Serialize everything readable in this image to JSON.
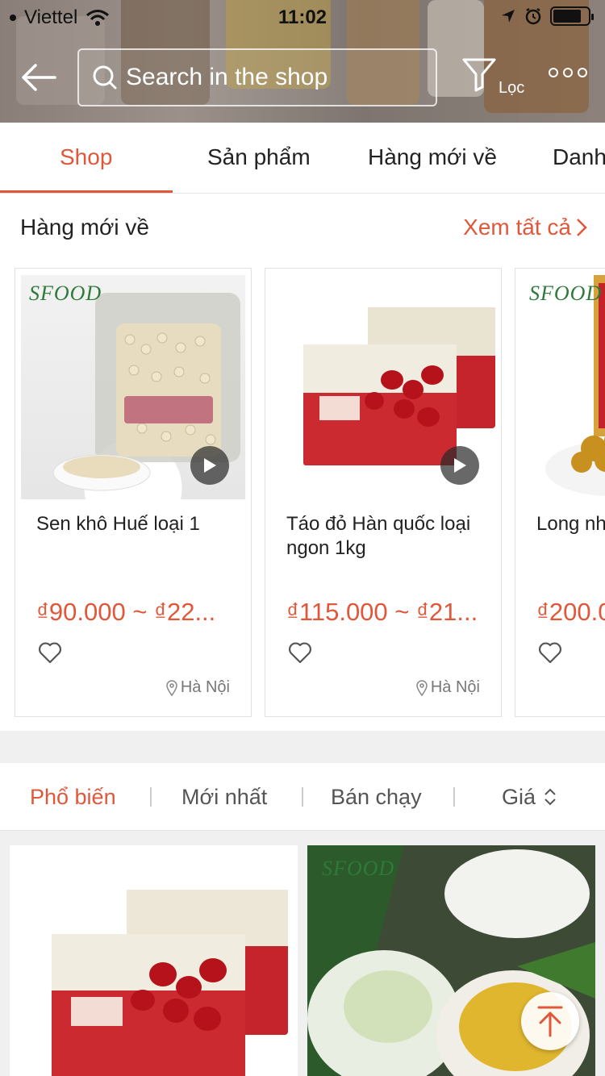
{
  "status_bar": {
    "carrier": "Viettel",
    "time": "11:02"
  },
  "header": {
    "search_placeholder": "Search in the shop",
    "filter_label": "Lọc"
  },
  "tabs": [
    {
      "label": "Shop",
      "active": true
    },
    {
      "label": "Sản phẩm",
      "active": false
    },
    {
      "label": "Hàng mới về",
      "active": false
    },
    {
      "label": "Danh",
      "active": false
    }
  ],
  "new_arrivals": {
    "title": "Hàng mới về",
    "see_all": "Xem tất cả",
    "products": [
      {
        "name": "Sen khô Huế loại 1",
        "price": "₫90.000 ~ ₫22...",
        "location": "Hà Nội",
        "brand": "SFOOD",
        "has_video": true
      },
      {
        "name": "Táo đỏ Hàn quốc loại ngon 1kg",
        "price": "₫115.000 ~ ₫21...",
        "location": "Hà Nội",
        "brand": "SFOOD",
        "has_video": true
      },
      {
        "name": "Long nh loại đặc",
        "price": "₫200.0",
        "location": "",
        "brand": "SFOOD",
        "has_video": false
      }
    ]
  },
  "sort_bar": {
    "items": [
      {
        "label": "Phổ biến",
        "active": true
      },
      {
        "label": "Mới nhất",
        "active": false
      },
      {
        "label": "Bán chạy",
        "active": false
      },
      {
        "label": "Giá",
        "active": false
      }
    ]
  },
  "grid": {
    "brand": "SFOOD"
  },
  "colors": {
    "accent": "#e0573a",
    "brand_green": "#2e7a3a"
  }
}
